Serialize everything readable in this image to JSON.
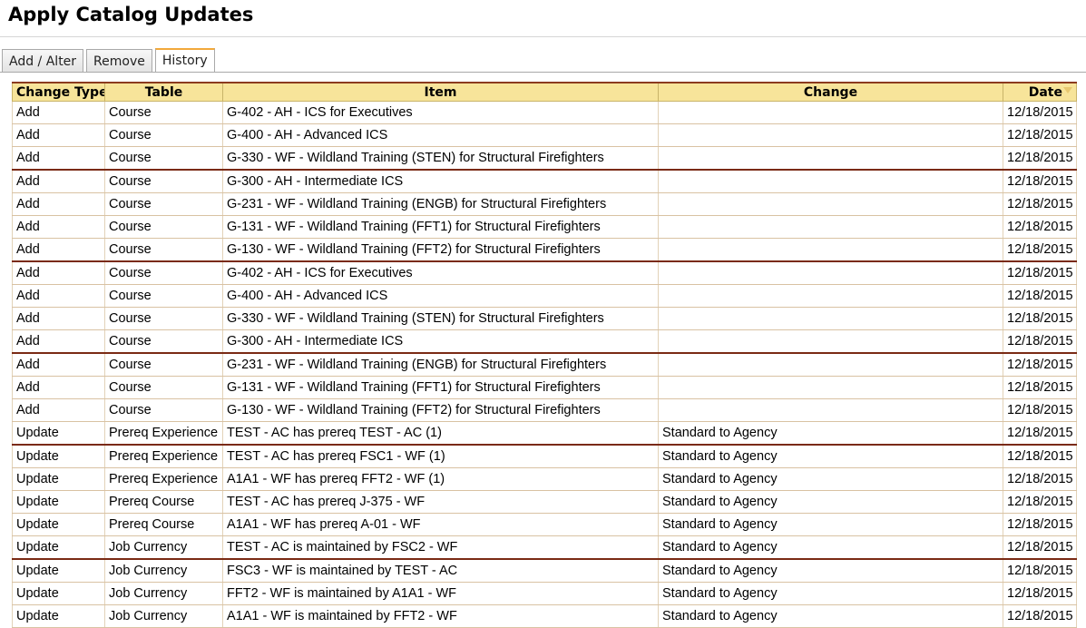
{
  "page": {
    "title": "Apply Catalog Updates"
  },
  "tabs": [
    {
      "label": "Add / Alter",
      "active": false
    },
    {
      "label": "Remove",
      "active": false
    },
    {
      "label": "History",
      "active": true
    }
  ],
  "table": {
    "columns": [
      "Change Type",
      "Table",
      "Item",
      "Change",
      "Date"
    ],
    "sorted_column": "Date",
    "rows": [
      {
        "type": "Add",
        "table": "Course",
        "item": "G-402 - AH - ICS for Executives",
        "change": "",
        "date": "12/18/2015"
      },
      {
        "type": "Add",
        "table": "Course",
        "item": "G-400 - AH - Advanced ICS",
        "change": "",
        "date": "12/18/2015"
      },
      {
        "type": "Add",
        "table": "Course",
        "item": "G-330 - WF - Wildland Training (STEN) for Structural Firefighters",
        "change": "",
        "date": "12/18/2015"
      },
      {
        "type": "Add",
        "table": "Course",
        "item": "G-300 - AH - Intermediate ICS",
        "change": "",
        "date": "12/18/2015"
      },
      {
        "type": "Add",
        "table": "Course",
        "item": "G-231 - WF - Wildland Training (ENGB) for Structural Firefighters",
        "change": "",
        "date": "12/18/2015"
      },
      {
        "type": "Add",
        "table": "Course",
        "item": "G-131 - WF - Wildland Training (FFT1) for Structural Firefighters",
        "change": "",
        "date": "12/18/2015"
      },
      {
        "type": "Add",
        "table": "Course",
        "item": "G-130 - WF - Wildland Training (FFT2) for Structural Firefighters",
        "change": "",
        "date": "12/18/2015"
      },
      {
        "type": "Add",
        "table": "Course",
        "item": "G-402 - AH - ICS for Executives",
        "change": "",
        "date": "12/18/2015"
      },
      {
        "type": "Add",
        "table": "Course",
        "item": "G-400 - AH - Advanced ICS",
        "change": "",
        "date": "12/18/2015"
      },
      {
        "type": "Add",
        "table": "Course",
        "item": "G-330 - WF - Wildland Training (STEN) for Structural Firefighters",
        "change": "",
        "date": "12/18/2015"
      },
      {
        "type": "Add",
        "table": "Course",
        "item": "G-300 - AH - Intermediate ICS",
        "change": "",
        "date": "12/18/2015"
      },
      {
        "type": "Add",
        "table": "Course",
        "item": "G-231 - WF - Wildland Training (ENGB) for Structural Firefighters",
        "change": "",
        "date": "12/18/2015"
      },
      {
        "type": "Add",
        "table": "Course",
        "item": "G-131 - WF - Wildland Training (FFT1) for Structural Firefighters",
        "change": "",
        "date": "12/18/2015"
      },
      {
        "type": "Add",
        "table": "Course",
        "item": "G-130 - WF - Wildland Training (FFT2) for Structural Firefighters",
        "change": "",
        "date": "12/18/2015"
      },
      {
        "type": "Update",
        "table": "Prereq Experience",
        "item": "TEST - AC has prereq TEST - AC (1)",
        "change": "Standard to Agency",
        "date": "12/18/2015"
      },
      {
        "type": "Update",
        "table": "Prereq Experience",
        "item": "TEST - AC has prereq FSC1 - WF (1)",
        "change": "Standard to Agency",
        "date": "12/18/2015"
      },
      {
        "type": "Update",
        "table": "Prereq Experience",
        "item": "A1A1 - WF has prereq FFT2 - WF (1)",
        "change": "Standard to Agency",
        "date": "12/18/2015"
      },
      {
        "type": "Update",
        "table": "Prereq Course",
        "item": "TEST - AC has prereq J-375 - WF",
        "change": "Standard to Agency",
        "date": "12/18/2015"
      },
      {
        "type": "Update",
        "table": "Prereq Course",
        "item": "A1A1 - WF has prereq A-01 - WF",
        "change": "Standard to Agency",
        "date": "12/18/2015"
      },
      {
        "type": "Update",
        "table": "Job Currency",
        "item": "TEST - AC is maintained by FSC2 - WF",
        "change": "Standard to Agency",
        "date": "12/18/2015"
      },
      {
        "type": "Update",
        "table": "Job Currency",
        "item": "FSC3 - WF is maintained by TEST - AC",
        "change": "Standard to Agency",
        "date": "12/18/2015"
      },
      {
        "type": "Update",
        "table": "Job Currency",
        "item": "FFT2 - WF is maintained by A1A1 - WF",
        "change": "Standard to Agency",
        "date": "12/18/2015"
      },
      {
        "type": "Update",
        "table": "Job Currency",
        "item": "A1A1 - WF is maintained by FFT2 - WF",
        "change": "Standard to Agency",
        "date": "12/18/2015"
      }
    ]
  }
}
